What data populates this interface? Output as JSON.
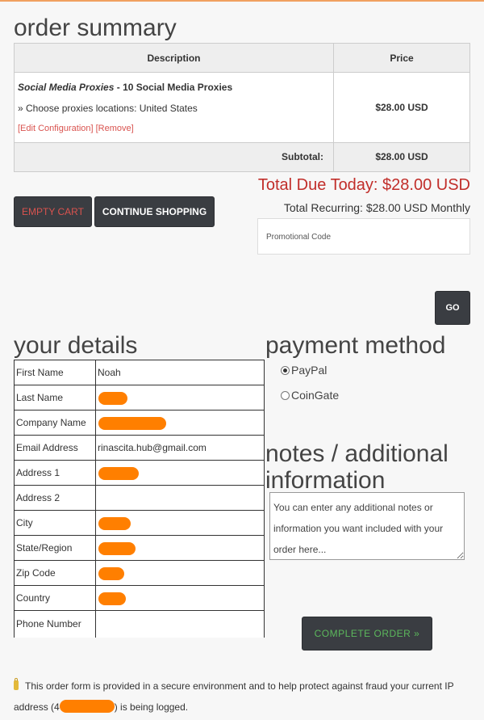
{
  "order_summary": {
    "title": "order summary",
    "columns": {
      "description": "Description",
      "price": "Price"
    },
    "item": {
      "group": "Social Media Proxies",
      "separator": " - ",
      "product": "10 Social Media Proxies",
      "option": "» Choose proxies locations: United States",
      "edit_link": "[Edit Configuration]",
      "remove_link": "[Remove]",
      "price": "$28.00 USD"
    },
    "subtotal_label": "Subtotal:",
    "subtotal_value": "$28.00 USD"
  },
  "totals": {
    "due_today": "Total Due Today: $28.00 USD",
    "recurring": "Total Recurring: $28.00 USD Monthly"
  },
  "buttons": {
    "empty_cart": "EMPTY CART",
    "continue_shopping": "CONTINUE SHOPPING",
    "go": "GO",
    "complete_order": "COMPLETE ORDER »"
  },
  "promo": {
    "placeholder": "Promotional Code"
  },
  "details": {
    "title": "your details",
    "fields": [
      {
        "label": "First Name",
        "value": "Noah"
      },
      {
        "label": "Last Name",
        "value": ""
      },
      {
        "label": "Company Name",
        "value": ""
      },
      {
        "label": "Email Address",
        "value": "rinascita.hub@gmail.com"
      },
      {
        "label": "Address 1",
        "value": ""
      },
      {
        "label": "Address 2",
        "value": ""
      },
      {
        "label": "City",
        "value": ""
      },
      {
        "label": "State/Region",
        "value": ""
      },
      {
        "label": "Zip Code",
        "value": ""
      },
      {
        "label": "Country",
        "value": ""
      },
      {
        "label": "Phone Number",
        "value": ""
      }
    ]
  },
  "payment": {
    "title": "payment method",
    "options": [
      {
        "label": "PayPal",
        "selected": true
      },
      {
        "label": "CoinGate",
        "selected": false
      }
    ]
  },
  "notes": {
    "title": "notes / additional information",
    "placeholder": "You can enter any additional notes or information you want included with your order here..."
  },
  "footer": {
    "text_before": "This order form is provided in a secure environment and to help protect against fraud your current IP address (4",
    "text_after": ") is being logged."
  },
  "colors": {
    "accent_red": "#c12e2a",
    "button_dark": "#3a3d42",
    "redaction": "#ff7f00",
    "complete_green": "#5cb85c"
  },
  "icons": {
    "lock": "lock-icon"
  }
}
